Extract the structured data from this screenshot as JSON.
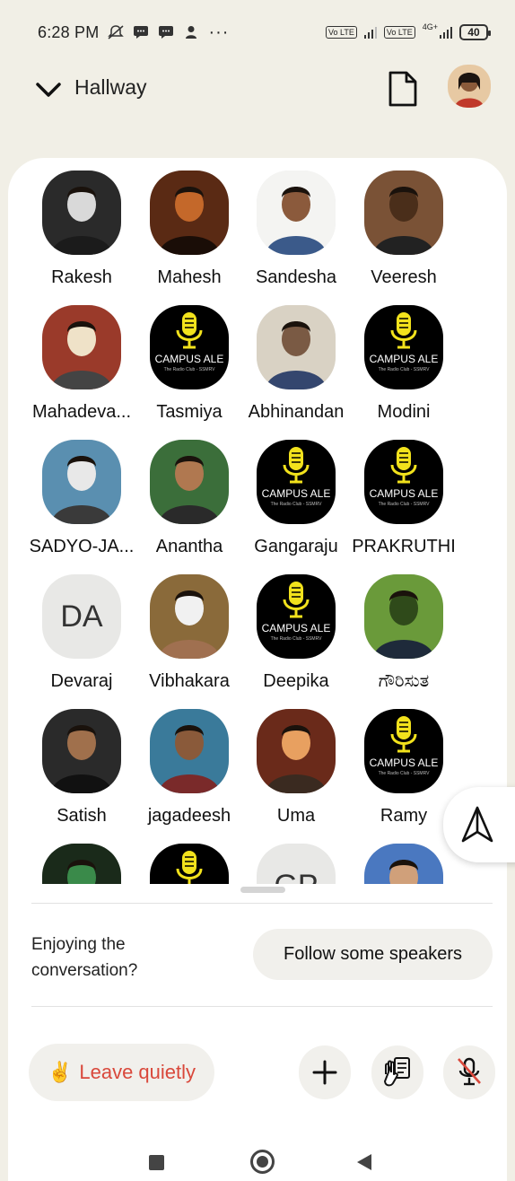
{
  "status_bar": {
    "time": "6:28 PM",
    "battery": "40",
    "net1": "Vo LTE",
    "net2": "Vo LTE",
    "net2_type": "4G+"
  },
  "header": {
    "room_title": "Hallway",
    "icons": [
      "chevron-down-icon",
      "document-icon",
      "profile-avatar"
    ]
  },
  "speakers": [
    {
      "name": "Rakesh",
      "avatar": "photo"
    },
    {
      "name": "Mahesh",
      "avatar": "photo"
    },
    {
      "name": "Sandesha",
      "avatar": "photo"
    },
    {
      "name": "Veeresh",
      "avatar": "photo"
    },
    {
      "name": "Mahadeva...",
      "avatar": "photo"
    },
    {
      "name": "Tasmiya",
      "avatar": "campus-logo"
    },
    {
      "name": "Abhinandan",
      "avatar": "photo"
    },
    {
      "name": "Modini",
      "avatar": "campus-logo"
    },
    {
      "name": "SADYO-JA...",
      "avatar": "photo"
    },
    {
      "name": "Anantha",
      "avatar": "photo"
    },
    {
      "name": "Gangaraju",
      "avatar": "campus-logo"
    },
    {
      "name": "PRAKRUTHI",
      "avatar": "campus-logo"
    },
    {
      "name": "Devaraj",
      "avatar": "initials",
      "initials": "DA"
    },
    {
      "name": "Vibhakara",
      "avatar": "photo"
    },
    {
      "name": "Deepika",
      "avatar": "campus-logo"
    },
    {
      "name": "ಗೌರಿಸುತ",
      "avatar": "photo"
    },
    {
      "name": "Satish",
      "avatar": "photo"
    },
    {
      "name": "jagadeesh",
      "avatar": "photo"
    },
    {
      "name": "Uma",
      "avatar": "photo"
    },
    {
      "name": "Ramy",
      "avatar": "campus-logo"
    },
    {
      "name": "",
      "avatar": "photo"
    },
    {
      "name": "",
      "avatar": "campus-logo"
    },
    {
      "name": "",
      "avatar": "initials",
      "initials": "GP"
    },
    {
      "name": "",
      "avatar": "photo"
    }
  ],
  "logo_text": {
    "main": "CAMPUS ALE",
    "sub": "The Radio Club - SSMRV"
  },
  "bottom": {
    "prompt": "Enjoying the conversation?",
    "follow_label": "Follow some speakers",
    "leave_label": "Leave quietly",
    "leave_emoji": "✌️"
  },
  "colors": {
    "background": "#f1efe6",
    "accent_red": "#d9483b",
    "logo_yellow": "#f2e21c"
  }
}
